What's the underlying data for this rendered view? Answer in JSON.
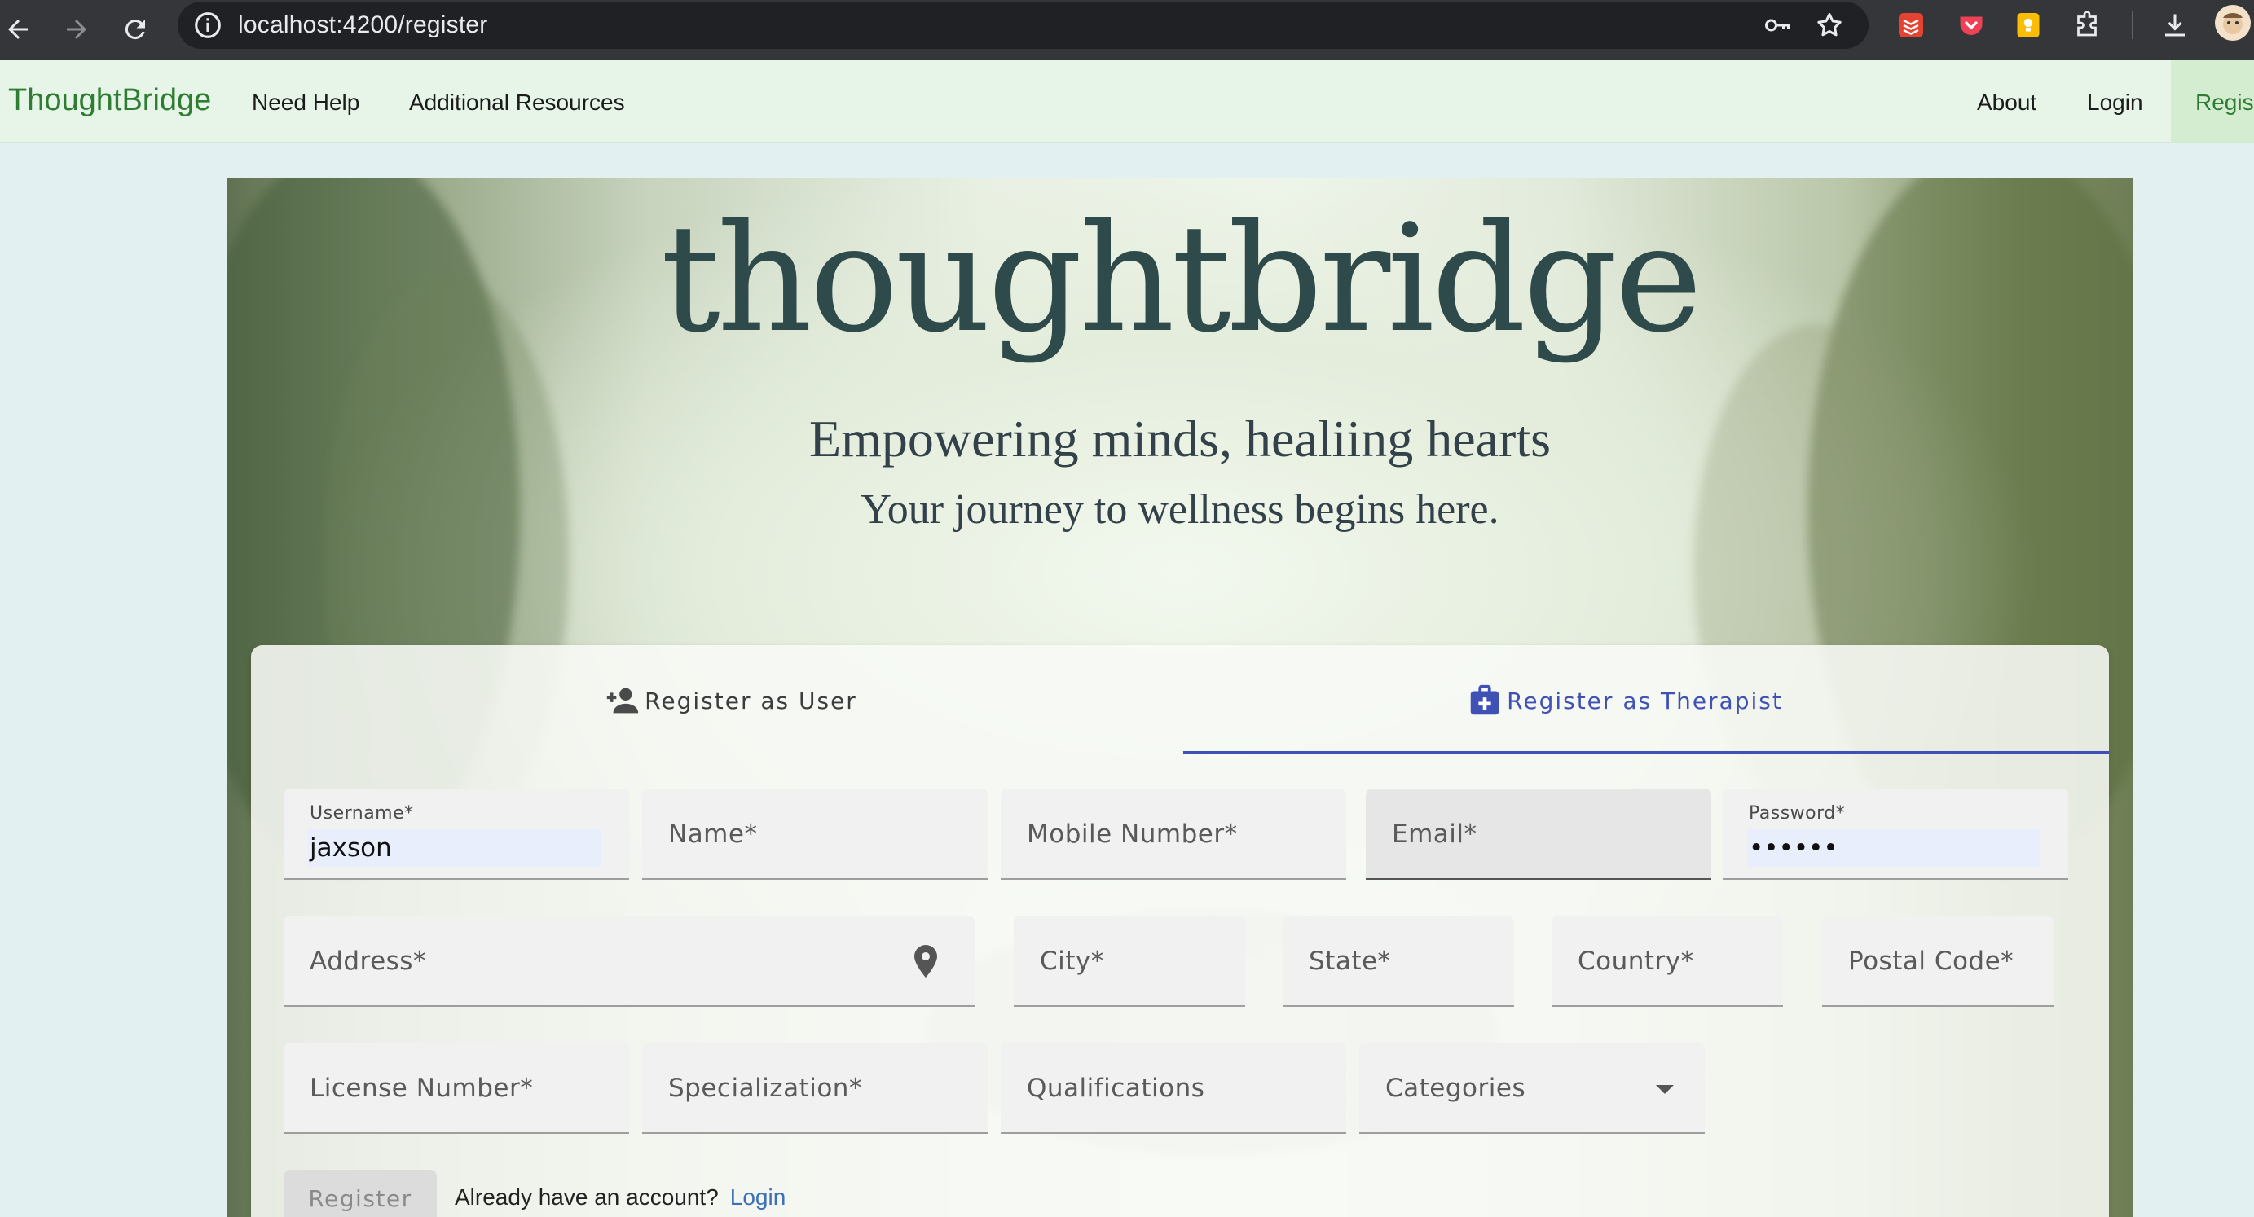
{
  "browser": {
    "url": "localhost:4200/register"
  },
  "navbar": {
    "brand": "ThoughtBridge",
    "left_links": [
      "Need Help",
      "Additional Resources"
    ],
    "right_links": [
      "About",
      "Login"
    ],
    "active_link": "Regist"
  },
  "hero": {
    "logo_text": "thoughtbridge",
    "tagline_1": "Empowering minds, healiing hearts",
    "tagline_2": "Your journey to wellness begins here."
  },
  "tabs": [
    {
      "label": "Register as User",
      "icon": "person-add-icon",
      "active": false
    },
    {
      "label": "Register as Therapist",
      "icon": "medical-bag-icon",
      "active": true
    }
  ],
  "form": {
    "username": {
      "label": "Username*",
      "value": "jaxson"
    },
    "name": {
      "label": "Name*"
    },
    "mobile": {
      "label": "Mobile Number*"
    },
    "email": {
      "label": "Email*"
    },
    "password": {
      "label": "Password*",
      "value": "••••••"
    },
    "address": {
      "label": "Address*",
      "icon": "location-pin-icon"
    },
    "city": {
      "label": "City*"
    },
    "state": {
      "label": "State*"
    },
    "country": {
      "label": "Country*"
    },
    "postal": {
      "label": "Postal Code*"
    },
    "license": {
      "label": "License Number*"
    },
    "specialization": {
      "label": "Specialization*"
    },
    "qualifications": {
      "label": "Qualifications"
    },
    "categories": {
      "label": "Categories"
    }
  },
  "footer": {
    "register_label": "Register",
    "already_text": "Already have an account?",
    "login_link": "Login"
  },
  "colors": {
    "accent": "#3f51b5",
    "brand": "#2e7d32",
    "navbar_bg": "#e6f5e8"
  }
}
